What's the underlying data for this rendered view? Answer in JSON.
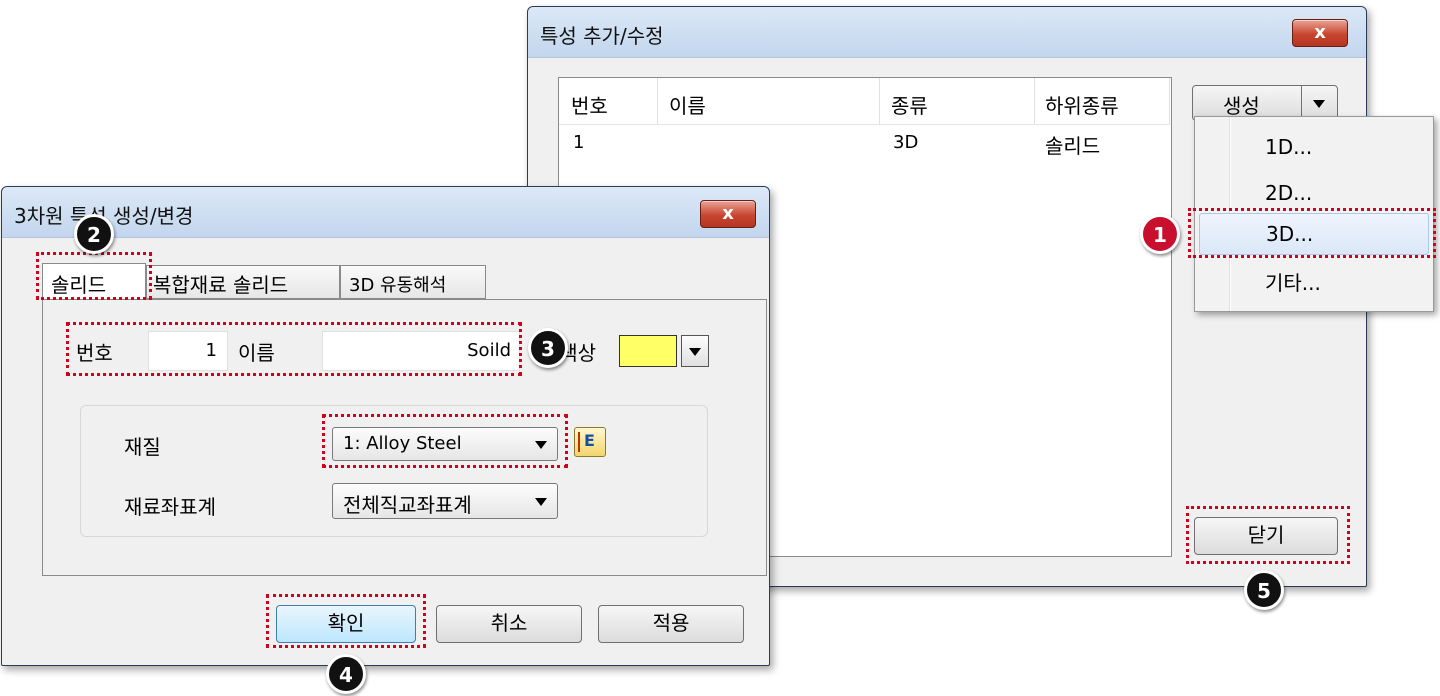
{
  "back_window": {
    "title": "특성 추가/수정",
    "close_label": "x",
    "columns": [
      "번호",
      "이름",
      "종류",
      "하위종류"
    ],
    "rows": [
      {
        "no": "1",
        "name": "",
        "type": "3D",
        "subtype": "솔리드"
      }
    ],
    "create_button": "생성",
    "menu_items": [
      "1D...",
      "2D...",
      "3D...",
      "기타..."
    ],
    "close_button": "닫기"
  },
  "front_window": {
    "title": "3차원 특성 생성/변경",
    "close_label": "x",
    "tabs": [
      "솔리드",
      "복합재료 솔리드",
      "3D 유동해석"
    ],
    "number_label": "번호",
    "number_value": "1",
    "name_label": "이름",
    "name_value": "Soild",
    "color_label": "색상",
    "color_value": "#ffff66",
    "material_label": "재질",
    "material_value": "1: Alloy Steel",
    "coord_label": "재료좌표계",
    "coord_value": "전체직교좌표계",
    "ok_button": "확인",
    "cancel_button": "취소",
    "apply_button": "적용"
  },
  "badges": [
    "1",
    "2",
    "3",
    "4",
    "5"
  ],
  "colors": {
    "highlight": "#d0021b",
    "badge_red": "#c8102e",
    "badge_dark": "#111111"
  }
}
